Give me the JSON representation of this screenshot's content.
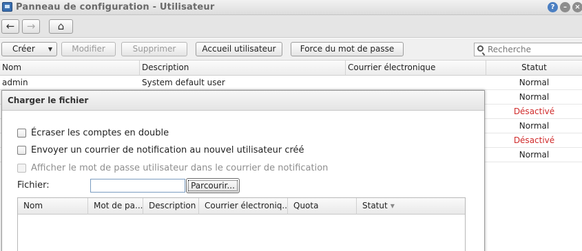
{
  "window": {
    "title": "Panneau de configuration - Utilisateur",
    "help_label": "?",
    "minimize_label": "–",
    "close_label": "×"
  },
  "nav": {
    "back_icon": "←",
    "forward_icon": "→",
    "home_icon": "⌂"
  },
  "toolbar": {
    "create_label": "Créer",
    "create_caret": "▼",
    "modify_label": "Modifier",
    "delete_label": "Supprimer",
    "user_home_label": "Accueil utilisateur",
    "force_password_label": "Force du mot de passe",
    "search_placeholder": "Recherche"
  },
  "table": {
    "columns": [
      "Nom",
      "Description",
      "Courrier électronique",
      "Statut"
    ],
    "rows": [
      {
        "name": "admin",
        "description": "System default user",
        "email": "",
        "status": "Normal",
        "status_type": "normal"
      },
      {
        "name": "",
        "description": "",
        "email": "",
        "status": "Normal",
        "status_type": "normal"
      },
      {
        "name": "",
        "description": "",
        "email": "",
        "status": "Désactivé",
        "status_type": "disabled"
      },
      {
        "name": "",
        "description": "",
        "email": "",
        "status": "Normal",
        "status_type": "normal"
      },
      {
        "name": "",
        "description": "",
        "email": "",
        "status": "Désactivé",
        "status_type": "disabled"
      },
      {
        "name": "",
        "description": "",
        "email": "",
        "status": "Normal",
        "status_type": "normal"
      }
    ],
    "status_colors": {
      "normal": "#222222",
      "disabled": "#d02a2a"
    }
  },
  "dialog": {
    "title": "Charger le fichier",
    "options": {
      "overwrite": "Écraser les comptes en double",
      "notify": "Envoyer un courrier de notification au nouvel utilisateur créé",
      "show_password": "Afficher le mot de passe utilisateur dans le courrier de notification"
    },
    "file_label": "Fichier:",
    "file_value": "",
    "browse_label": "Parcourir...",
    "grid_columns": [
      "Nom",
      "Mot de pa...",
      "Description",
      "Courrier électroniq...",
      "Quota",
      "Statut"
    ]
  }
}
